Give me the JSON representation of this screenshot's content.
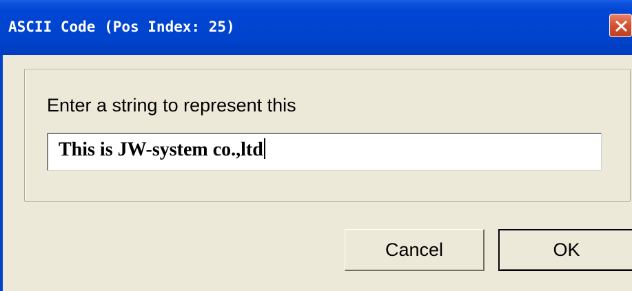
{
  "dialog": {
    "title": "ASCII Code (Pos Index: 25)",
    "prompt": "Enter a string to represent this",
    "input_value": "This is JW-system co.,ltd",
    "cancel_label": "Cancel",
    "ok_label": "OK"
  },
  "icons": {
    "close": "close-icon"
  },
  "colors": {
    "titlebar": "#0043cc",
    "close_button": "#d5512f",
    "dialog_bg": "#ece9d8"
  }
}
